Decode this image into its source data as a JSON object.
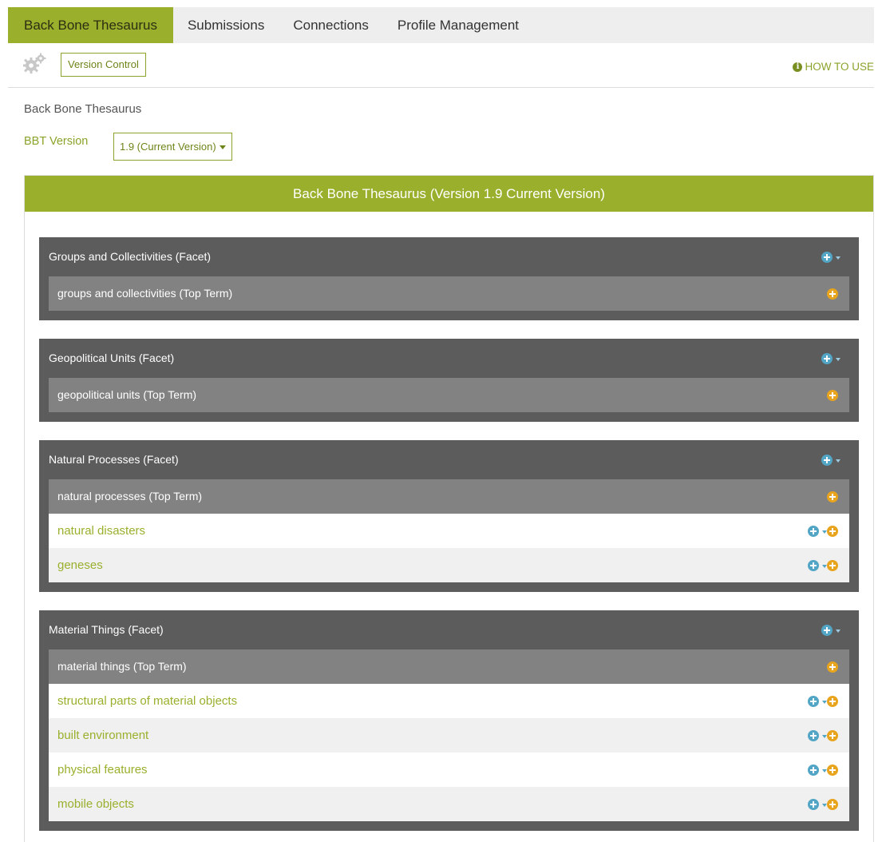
{
  "nav": {
    "tabs": [
      {
        "label": "Back Bone Thesaurus",
        "active": true
      },
      {
        "label": "Submissions",
        "active": false
      },
      {
        "label": "Connections",
        "active": false
      },
      {
        "label": "Profile Management",
        "active": false
      }
    ]
  },
  "toolbar": {
    "settings_icon": "gears-icon",
    "version_control_label": "Version Control",
    "how_to_use_label": "HOW TO USE",
    "info_icon": "info-icon"
  },
  "breadcrumb": "Back Bone Thesaurus",
  "version": {
    "label": "BBT Version",
    "selected": "1.9 (Current Version)"
  },
  "panel": {
    "title": "Back Bone Thesaurus (Version 1.9 Current Version)"
  },
  "facets": [
    {
      "title": "Groups and Collectivities (Facet)",
      "top_term": "groups and collectivities (Top Term)",
      "terms": []
    },
    {
      "title": "Geopolitical Units (Facet)",
      "top_term": "geopolitical units (Top Term)",
      "terms": []
    },
    {
      "title": "Natural Processes (Facet)",
      "top_term": "natural processes (Top Term)",
      "terms": [
        "natural disasters",
        "geneses"
      ]
    },
    {
      "title": "Material Things (Facet)",
      "top_term": "material things (Top Term)",
      "terms": [
        "structural parts of material objects",
        "built environment",
        "physical features",
        "mobile objects"
      ]
    }
  ],
  "colors": {
    "accent": "#9aaf2c",
    "facet_bg": "#5c5c5c",
    "top_term_bg": "#828282",
    "add_blue": "#52a5c4",
    "add_orange": "#e8a41c"
  }
}
